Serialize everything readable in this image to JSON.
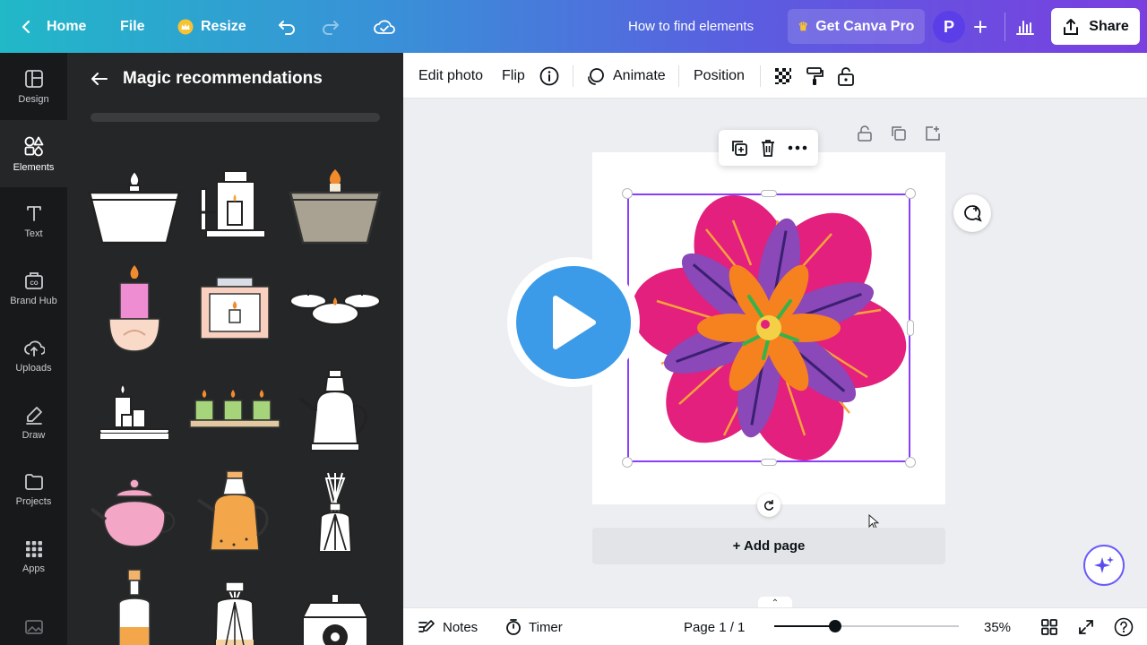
{
  "topbar": {
    "home_label": "Home",
    "file_label": "File",
    "resize_label": "Resize",
    "doc_title": "How to find elements",
    "pro_label": "Get Canva Pro",
    "avatar_initial": "P",
    "share_label": "Share"
  },
  "rail": {
    "items": [
      {
        "label": "Design",
        "icon": "design-icon"
      },
      {
        "label": "Elements",
        "icon": "elements-icon"
      },
      {
        "label": "Text",
        "icon": "text-icon"
      },
      {
        "label": "Brand Hub",
        "icon": "brand-hub-icon"
      },
      {
        "label": "Uploads",
        "icon": "uploads-icon"
      },
      {
        "label": "Draw",
        "icon": "draw-icon"
      },
      {
        "label": "Projects",
        "icon": "projects-icon"
      },
      {
        "label": "Apps",
        "icon": "apps-icon"
      }
    ],
    "active": "Elements"
  },
  "panel": {
    "title": "Magic recommendations",
    "elements": [
      "white-candle-bowl",
      "lantern",
      "gray-candle-bowl",
      "pink-candle",
      "framed-candle",
      "floating-candles",
      "candle-set",
      "green-candle-tray",
      "white-teapot",
      "pink-teapot",
      "orange-oil-jug",
      "reed-diffuser",
      "orange-bottle",
      "diffuser-jar",
      "scale"
    ]
  },
  "toolbar": {
    "edit_photo_label": "Edit photo",
    "flip_label": "Flip",
    "animate_label": "Animate",
    "position_label": "Position"
  },
  "canvas": {
    "add_page_label": "+ Add page",
    "selected_element": "flower-illustration"
  },
  "footer": {
    "notes_label": "Notes",
    "timer_label": "Timer",
    "page_indicator": "Page 1 / 1",
    "zoom_label": "35%",
    "zoom_fraction": 0.33
  },
  "colors": {
    "accent": "#8b3dff",
    "rail_bg": "#18191b",
    "panel_bg": "#252627",
    "play_blue": "#3c9be8"
  }
}
